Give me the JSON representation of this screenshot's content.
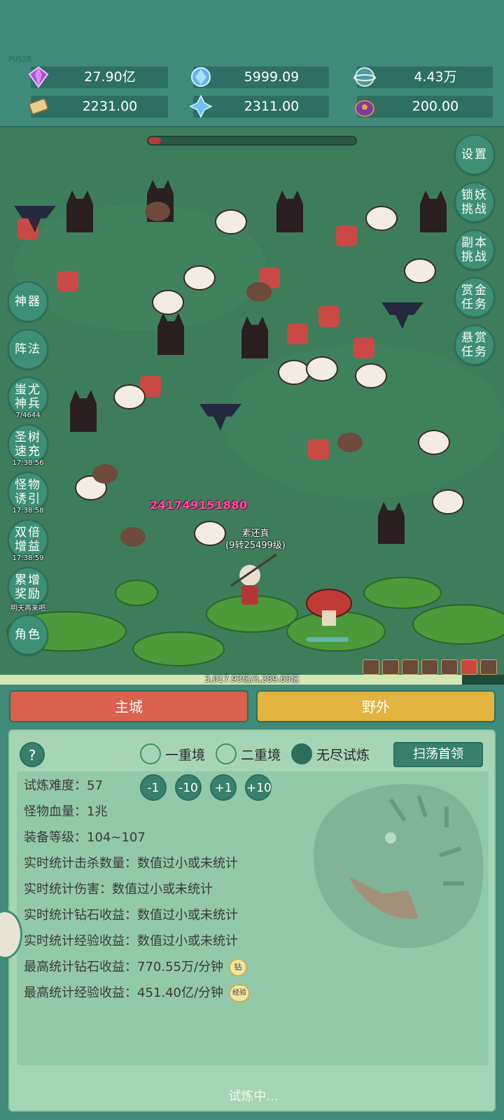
{
  "header": {
    "build_tag": "PU52R",
    "resources": [
      {
        "icon": "purple-gem-icon",
        "value": "27.90亿"
      },
      {
        "icon": "blue-crystal-icon",
        "value": "5999.09"
      },
      {
        "icon": "planet-orb-icon",
        "value": "4.43万"
      },
      {
        "icon": "scroll-icon",
        "value": "2231.00"
      },
      {
        "icon": "ice-shard-icon",
        "value": "2311.00"
      },
      {
        "icon": "purple-pouch-icon",
        "value": "200.00"
      }
    ]
  },
  "game": {
    "stage_progress": 0.06,
    "right_buttons": [
      {
        "label": "设置",
        "icon": "settings"
      },
      {
        "label": "锁妖挑战",
        "icon": "lock-demon"
      },
      {
        "label": "副本挑战",
        "icon": "dungeon"
      },
      {
        "label": "赏金任务",
        "icon": "bounty"
      },
      {
        "label": "悬赏任务",
        "icon": "reward"
      }
    ],
    "left_buttons": [
      {
        "label": "神器",
        "caption": ""
      },
      {
        "label": "阵法",
        "caption": ""
      },
      {
        "label": "蚩尤神兵",
        "caption": "7/4644"
      },
      {
        "label": "圣树速充",
        "caption": "17:38:56"
      },
      {
        "label": "怪物诱引",
        "caption": "17:38:58"
      },
      {
        "label": "双倍增益",
        "caption": "17:38:59"
      },
      {
        "label": "累增奖励",
        "caption": "明天再来吧"
      },
      {
        "label": "角色",
        "caption": ""
      }
    ],
    "damage_number": "241749151880",
    "hero_name": "素还真",
    "hero_level": "(9转25499级)",
    "exp_text": "3,017.93亿/3,289.65亿",
    "exp_progress": 0.917
  },
  "tabs": {
    "city": "主城",
    "field": "野外"
  },
  "trial": {
    "help": "?",
    "modes": [
      {
        "label": "一重境",
        "selected": false
      },
      {
        "label": "二重境",
        "selected": false
      },
      {
        "label": "无尽试炼",
        "selected": true
      }
    ],
    "sweep_button": "扫荡首领",
    "difficulty_label": "试炼难度：",
    "difficulty_value": "57",
    "adjust_buttons": [
      "-1",
      "-10",
      "+1",
      "+10"
    ],
    "stats": [
      "怪物血量：1兆",
      "装备等级：104~107",
      "实时统计击杀数量：数值过小或未统计",
      "实时统计伤害：数值过小或未统计",
      "实时统计钻石收益：数值过小或未统计",
      "实时统计经验收益：数值过小或未统计",
      "最高统计钻石收益：770.55万/分钟",
      "最高统计经验收益：451.40亿/分钟"
    ],
    "diamond_badge": "钻",
    "exp_badge": "经验",
    "status": "试炼中..."
  },
  "colors": {
    "bg": "#3f8a78",
    "city_tab": "#d9614e",
    "field_tab": "#e2b33e",
    "panel": "#a6d5b6",
    "damage": "#ff4fa2"
  }
}
